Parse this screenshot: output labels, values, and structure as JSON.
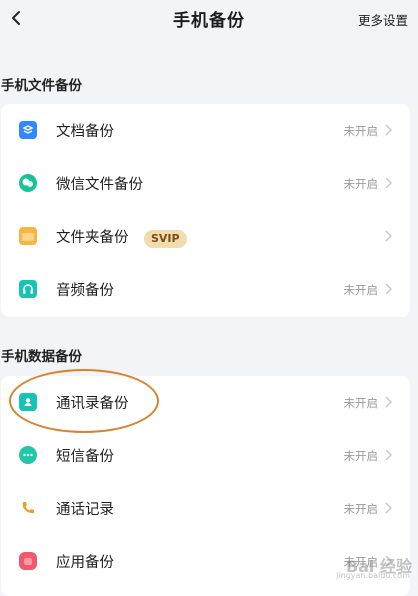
{
  "header": {
    "title": "手机备份",
    "more_label": "更多设置"
  },
  "section_file": {
    "title": "手机文件备份",
    "items": [
      {
        "label": "文档备份",
        "status": "未开启",
        "icon": "document-icon",
        "color": "#2f88ff"
      },
      {
        "label": "微信文件备份",
        "status": "未开启",
        "icon": "wechat-icon",
        "color": "#19c39a"
      },
      {
        "label": "文件夹备份",
        "status": "",
        "badge": "SVIP",
        "icon": "folder-icon",
        "color": "#f7b640"
      },
      {
        "label": "音频备份",
        "status": "未开启",
        "icon": "headphones-icon",
        "color": "#16c3b5"
      }
    ]
  },
  "section_data": {
    "title": "手机数据备份",
    "items": [
      {
        "label": "通讯录备份",
        "status": "未开启",
        "icon": "contacts-icon",
        "color": "#16c3b5"
      },
      {
        "label": "短信备份",
        "status": "未开启",
        "icon": "message-icon",
        "color": "#21c7a8"
      },
      {
        "label": "通话记录",
        "status": "未开启",
        "icon": "phone-icon",
        "color": "#f39b22"
      },
      {
        "label": "应用备份",
        "status": "未开启",
        "icon": "app-icon",
        "color": "#f2586b"
      }
    ]
  },
  "watermark": {
    "text": "Bai 经验",
    "sub": "jingyan.baidu.com"
  }
}
